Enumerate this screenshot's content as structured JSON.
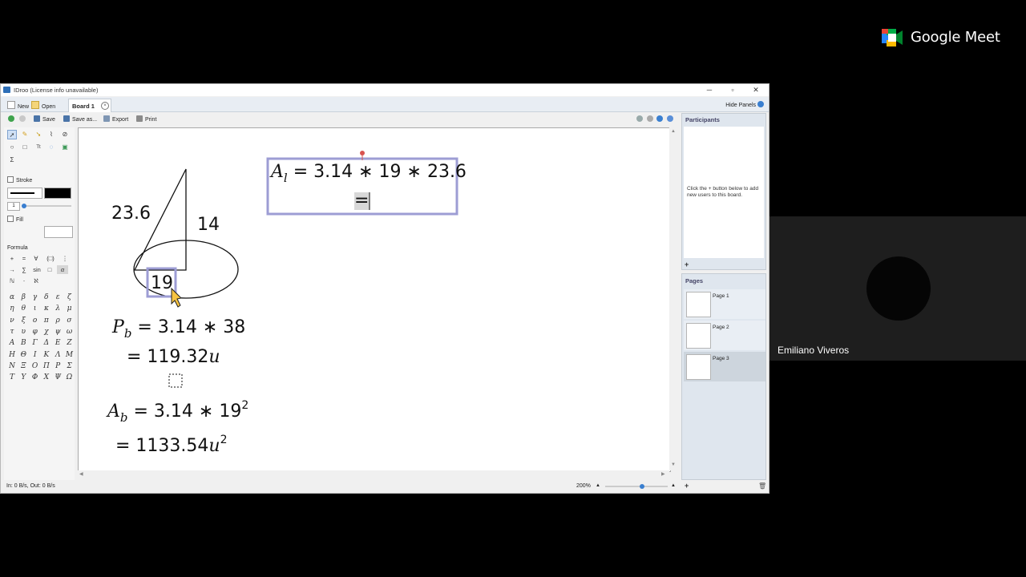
{
  "meet": {
    "brand": "Google Meet",
    "participant_name": "Emiliano Viveros",
    "colors": {
      "green": "#00ac47",
      "blue": "#2684fc",
      "yellow": "#ffba00",
      "red": "#ea4335"
    }
  },
  "app": {
    "title": "IDroo (License info unavailable)",
    "window_controls": {
      "minimize": "─",
      "maximize": "▫",
      "close": "✕"
    },
    "menu": {
      "new": "New",
      "open": "Open",
      "tab": "Board 1",
      "hide_panels": "Hide Panels"
    },
    "toolbar": {
      "save": "Save",
      "save_as": "Save as...",
      "export": "Export",
      "print": "Print"
    },
    "tools": {
      "stroke_label": "Stroke",
      "stroke_width": "1",
      "fill_label": "Fill",
      "formula_label": "Formula",
      "sigma": "Σ",
      "text_tool": "Tt"
    },
    "formula_buttons": [
      "+",
      "=",
      "∀",
      "(□)",
      "⋮",
      "→",
      "∑",
      "sin",
      "□",
      "α",
      "ℕ",
      "⸱",
      "ℵ"
    ],
    "greek": [
      "α",
      "β",
      "γ",
      "δ",
      "ε",
      "ζ",
      "η",
      "θ",
      "ι",
      "κ",
      "λ",
      "μ",
      "ν",
      "ξ",
      "ο",
      "π",
      "ρ",
      "σ",
      "τ",
      "υ",
      "φ",
      "χ",
      "ψ",
      "ω",
      "A",
      "B",
      "Γ",
      "Δ",
      "E",
      "Z",
      "H",
      "Θ",
      "I",
      "K",
      "Λ",
      "M",
      "N",
      "Ξ",
      "O",
      "Π",
      "P",
      "Σ",
      "T",
      "Υ",
      "Φ",
      "X",
      "Ψ",
      "Ω"
    ],
    "board": {
      "label_slant": "23.6",
      "label_height": "14",
      "label_radius": "19",
      "formula_perimeter": {
        "var": "P",
        "sub": "b",
        "rhs": "= 3.14 ∗ 38"
      },
      "formula_perimeter_result": {
        "pre": "= 119.32",
        "unit": "u"
      },
      "formula_base_area": {
        "var": "A",
        "sub": "b",
        "rhs": "= 3.14 ∗ 19",
        "exp": "2"
      },
      "formula_base_area_result": {
        "pre": "= 1133.54",
        "unit": "u",
        "exp": "2"
      },
      "formula_lateral": {
        "var": "A",
        "sub": "l",
        "rhs": "= 3.14 ∗ 19 ∗ 23.6"
      },
      "formula_lateral_next": "="
    },
    "participants": {
      "title": "Participants",
      "hint": "Click the + button below to add new users to this board."
    },
    "pages": {
      "title": "Pages",
      "items": [
        "Page 1",
        "Page 2",
        "Page 3"
      ],
      "selected": "Page 3"
    },
    "status": {
      "io": "In: 0 B/s, Out: 0 B/s",
      "zoom": "200%"
    }
  }
}
